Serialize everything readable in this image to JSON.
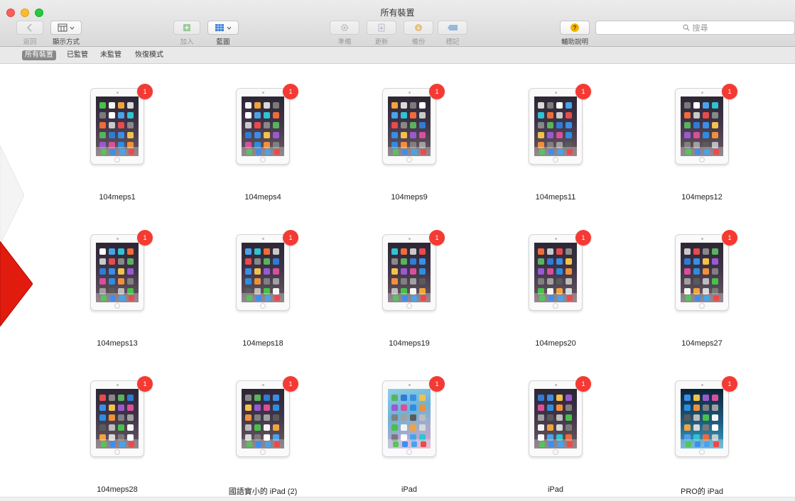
{
  "window": {
    "title": "所有裝置"
  },
  "toolbar": {
    "back_label": "返回",
    "view_label": "顯示方式",
    "add_label": "加入",
    "blueprint_label": "藍圖",
    "prepare_label": "準備",
    "update_label": "更新",
    "backup_label": "備份",
    "tag_label": "標記",
    "help_label": "輔助說明",
    "help_symbol": "?"
  },
  "search": {
    "placeholder": "搜尋",
    "icon": "magnifier-icon"
  },
  "filters": [
    {
      "label": "所有裝置",
      "active": true
    },
    {
      "label": "已監管",
      "active": false
    },
    {
      "label": "未監管",
      "active": false
    },
    {
      "label": "恢復模式",
      "active": false
    }
  ],
  "devices": [
    {
      "name": "104meps1",
      "badge": "1",
      "wallpaper": "default"
    },
    {
      "name": "104meps4",
      "badge": "1",
      "wallpaper": "default"
    },
    {
      "name": "104meps9",
      "badge": "1",
      "wallpaper": "default"
    },
    {
      "name": "104meps11",
      "badge": "1",
      "wallpaper": "default"
    },
    {
      "name": "104meps12",
      "badge": "1",
      "wallpaper": "default"
    },
    {
      "name": "104meps13",
      "badge": "1",
      "wallpaper": "default"
    },
    {
      "name": "104meps18",
      "badge": "1",
      "wallpaper": "default"
    },
    {
      "name": "104meps19",
      "badge": "1",
      "wallpaper": "default"
    },
    {
      "name": "104meps20",
      "badge": "1",
      "wallpaper": "default"
    },
    {
      "name": "104meps27",
      "badge": "1",
      "wallpaper": "default"
    },
    {
      "name": "104meps28",
      "badge": "1",
      "wallpaper": "default"
    },
    {
      "name": "國語實小的 iPad (2)",
      "badge": "1",
      "wallpaper": "default"
    },
    {
      "name": "iPad",
      "badge": "1",
      "wallpaper": "blue"
    },
    {
      "name": "iPad",
      "badge": "1",
      "wallpaper": "default"
    },
    {
      "name": "PRO的 iPad",
      "badge": "1",
      "wallpaper": "sea"
    }
  ],
  "colors": {
    "badge": "#f43a33",
    "active_filter": "#888888",
    "overlay_arrow": "#e11b0e"
  }
}
